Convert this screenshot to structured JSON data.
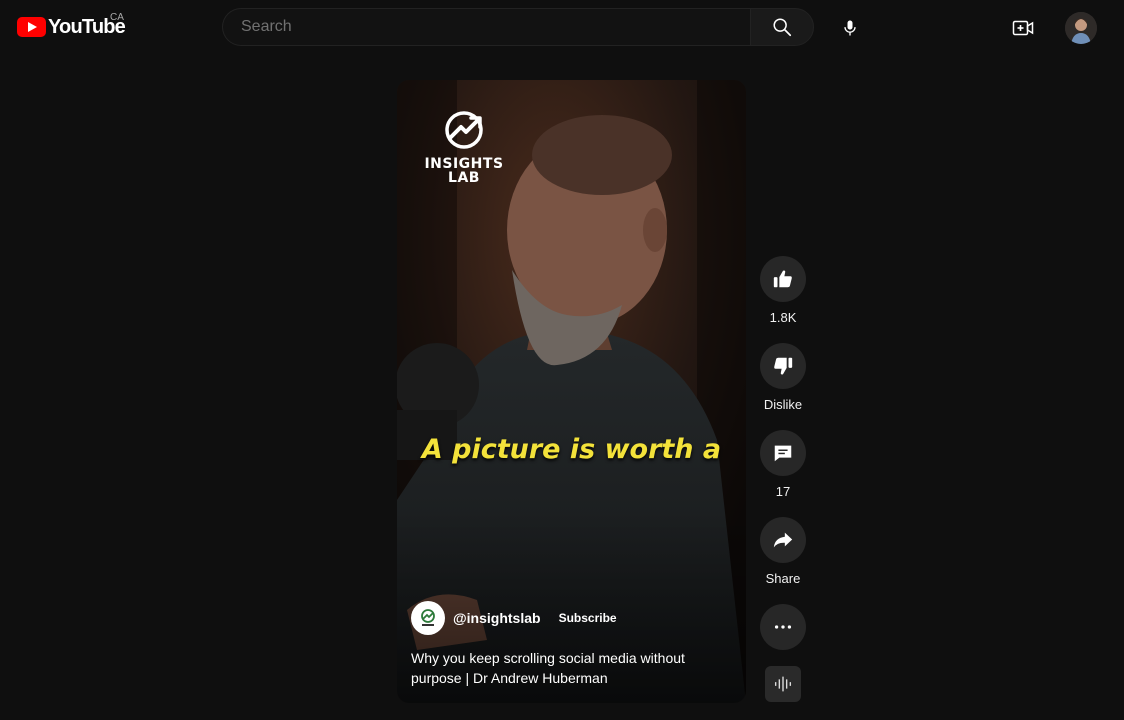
{
  "masthead": {
    "logo_text": "YouTube",
    "country_code": "CA",
    "search_placeholder": "Search"
  },
  "video": {
    "watermark_line1": "INSIGHTS",
    "watermark_line2": "LAB",
    "caption": "A picture is worth a",
    "channel_handle": "@insightslab",
    "subscribe_label": "Subscribe",
    "title": "Why you keep scrolling social media without purpose | Dr Andrew Huberman"
  },
  "actions": {
    "like_count": "1.8K",
    "dislike_label": "Dislike",
    "comment_count": "17",
    "share_label": "Share"
  },
  "icons": {
    "search": "search-icon",
    "mic": "mic-icon",
    "create": "video-plus-icon",
    "like": "thumbs-up-icon",
    "dislike": "thumbs-down-icon",
    "comment": "comment-icon",
    "share": "share-icon",
    "more": "more-horizontal-icon",
    "sound": "audio-wave-icon"
  },
  "colors": {
    "background": "#0f0f0f",
    "brand_red": "#ff0000",
    "caption_yellow": "#f3e23a",
    "button_bg": "#272727"
  }
}
